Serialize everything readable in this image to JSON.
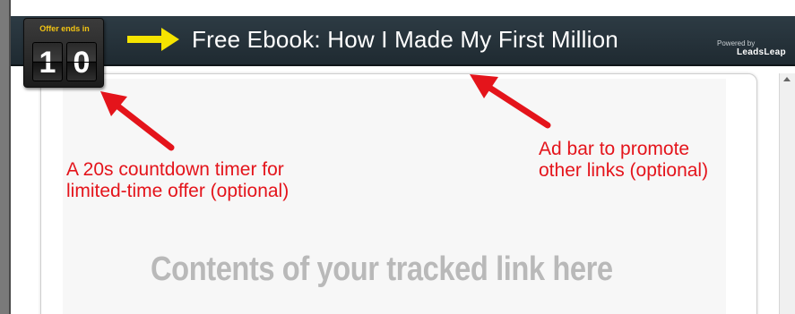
{
  "timer": {
    "label": "Offer ends in",
    "digits": [
      "1",
      "0"
    ]
  },
  "ad_bar": {
    "text": "Free Ebook: How I Made My First Million",
    "powered_by": "Powered by",
    "brand": "LeadsLeap"
  },
  "content": {
    "placeholder": "Contents of your tracked link here"
  },
  "annotations": {
    "timer_lines": [
      "A 20s countdown timer for",
      "limited-time offer (optional)"
    ],
    "ad_bar_lines": [
      "Ad bar to promote",
      "other links (optional)"
    ]
  },
  "colors": {
    "annotation": "#e4141b",
    "ad_bar": "#27343c",
    "timer_label": "#f3c413",
    "arrow_yellow": "#f5e400",
    "placeholder_text": "#b9b9b9"
  },
  "icons": {
    "ad_pointer": "yellow-right-arrow",
    "callouts": "red-arrow"
  }
}
